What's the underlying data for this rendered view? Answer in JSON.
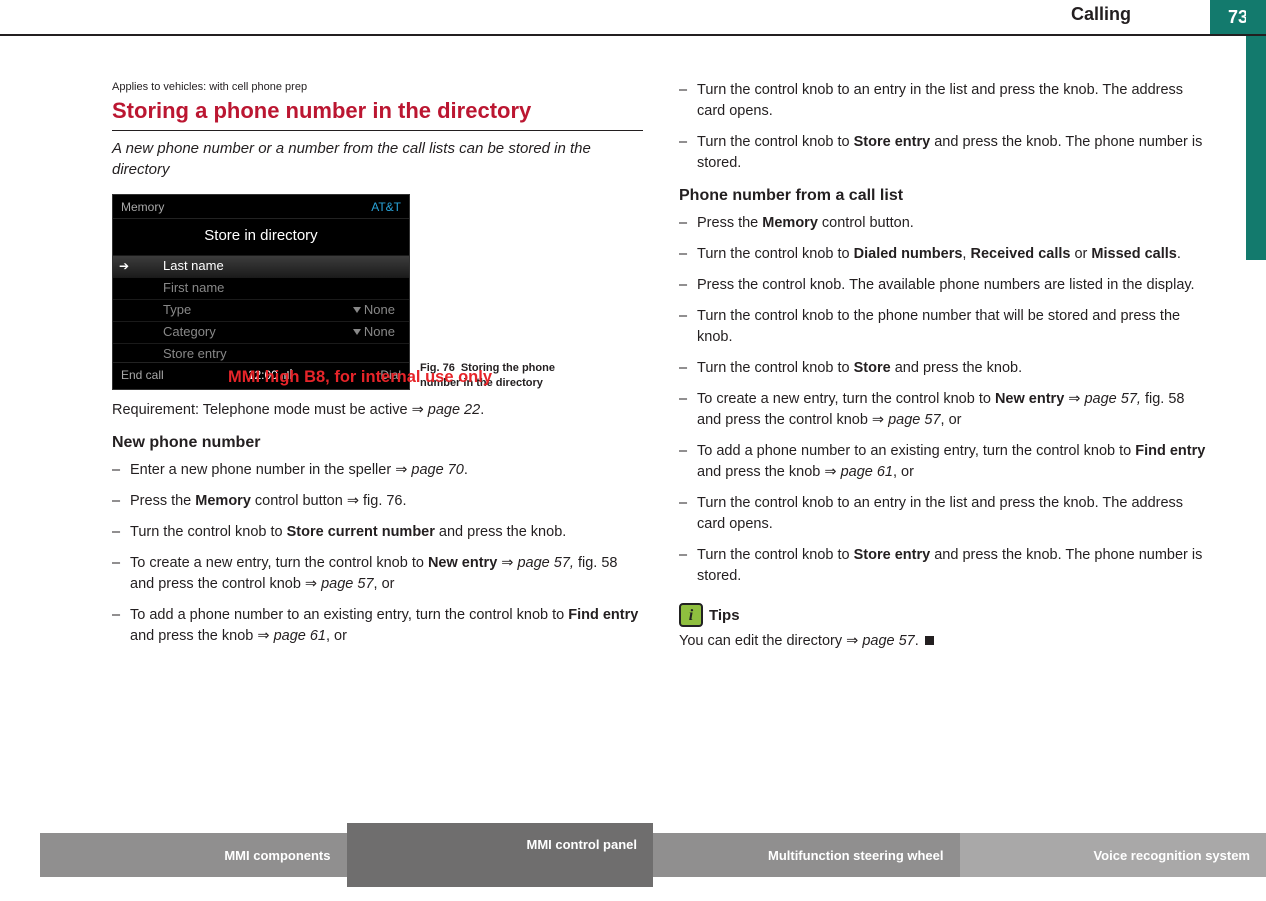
{
  "header": {
    "chapter": "Calling",
    "page": "73"
  },
  "article": {
    "applies": "Applies to vehicles: with cell phone prep",
    "title": "Storing a phone number in the directory",
    "intro": "A new phone number or a number from the call lists can be stored in the directory",
    "figure": {
      "number": "Fig. 76",
      "caption": "Storing the phone number in the directory",
      "screen": {
        "top_left": "Memory",
        "carrier": "AT&T",
        "heading": "Store in directory",
        "rows": [
          {
            "label": "Last name",
            "value": ""
          },
          {
            "label": "First name",
            "value": ""
          },
          {
            "label": "Type",
            "value": "None"
          },
          {
            "label": "Category",
            "value": "None"
          },
          {
            "label": "Store entry",
            "value": ""
          }
        ],
        "bottom_left": "End call",
        "time": "12:00",
        "bottom_right": "Dial"
      }
    },
    "watermark": "MMI high B8, for internal use only",
    "requirement_pre": "Requirement: Telephone mode must be active ",
    "requirement_ref": "page 22",
    "sub1": "New phone number",
    "steps1": {
      "s1_a": "Enter a new phone number in the speller ",
      "s1_ref": "page 70",
      "s2_a": "Press the ",
      "s2_b": "Memory",
      "s2_c": " control button ",
      "s2_ref": "fig. 76",
      "s3_a": "Turn the control knob to ",
      "s3_b": "Store current number",
      "s3_c": " and press the knob.",
      "s4_a": "To create a new entry, turn the control knob to ",
      "s4_b": "New entry",
      "s4_ref1": "page 57,",
      "s4_mid": " fig. 58 and press the control knob ",
      "s4_ref2": "page 57",
      "s4_end": ", or",
      "s5_a": "To add a phone number to an existing entry, turn the control knob to ",
      "s5_b": "Find entry",
      "s5_c": " and press the knob ",
      "s5_ref": "page 61",
      "s5_end": ", or"
    },
    "col2_top": {
      "t1_a": "Turn the control knob to an entry in the list and press the knob. The address card opens.",
      "t2_a": "Turn the control knob to ",
      "t2_b": "Store entry",
      "t2_c": " and press the knob. The phone number is stored."
    },
    "sub2": "Phone number from a call list",
    "steps2": {
      "p1_a": "Press the ",
      "p1_b": "Memory",
      "p1_c": " control button.",
      "p2_a": "Turn the control knob to ",
      "p2_b": "Dialed numbers",
      "p2_c": ", ",
      "p2_d": "Received calls",
      "p2_e": " or ",
      "p2_f": "Missed calls",
      "p2_g": ".",
      "p3": "Press the control knob. The available phone numbers are listed in the display.",
      "p4": "Turn the control knob to the phone number that will be stored and press the knob.",
      "p5_a": "Turn the control knob to ",
      "p5_b": "Store",
      "p5_c": " and press the knob.",
      "p6_a": "To create a new entry, turn the control knob to ",
      "p6_b": "New entry",
      "p6_ref1": "page 57,",
      "p6_mid": " fig. 58 and press the control knob ",
      "p6_ref2": "page 57",
      "p6_end": ", or",
      "p7_a": "To add a phone number to an existing entry, turn the control knob to ",
      "p7_b": "Find entry",
      "p7_c": " and press the knob ",
      "p7_ref": "page 61",
      "p7_end": ", or",
      "p8": "Turn the control knob to an entry in the list and press the knob. The address card opens.",
      "p9_a": "Turn the control knob to ",
      "p9_b": "Store entry",
      "p9_c": " and press the knob. The phone number is stored."
    },
    "tips": {
      "label": "Tips",
      "text_a": "You can edit the directory ",
      "text_ref": "page 57"
    }
  },
  "footer": {
    "t1": "MMI components",
    "t2": "MMI control panel",
    "t3": "Multifunction steering wheel",
    "t4": "Voice recognition system"
  },
  "glyphs": {
    "double_arrow": "⇒",
    "dot": "."
  }
}
